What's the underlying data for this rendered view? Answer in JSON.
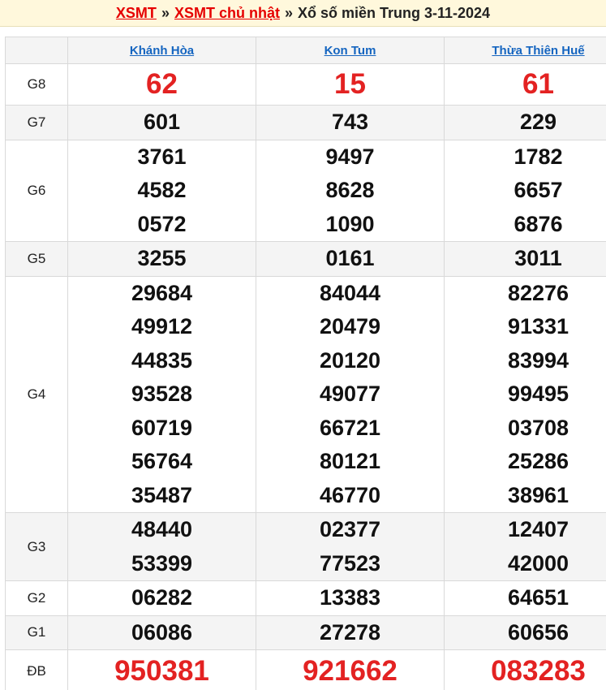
{
  "header": {
    "link1": "XSMT",
    "sep1": "»",
    "link2": "XSMT chủ nhật",
    "sep2": "»",
    "title": "Xổ số miền Trung 3-11-2024"
  },
  "provinces": [
    "Khánh Hòa",
    "Kon Tum",
    "Thừa Thiên Huế"
  ],
  "prizes": [
    {
      "label": "G8",
      "style": "big",
      "values": [
        [
          "62"
        ],
        [
          "15"
        ],
        [
          "61"
        ]
      ]
    },
    {
      "label": "G7",
      "style": "normal",
      "values": [
        [
          "601"
        ],
        [
          "743"
        ],
        [
          "229"
        ]
      ]
    },
    {
      "label": "G6",
      "style": "normal",
      "values": [
        [
          "3761",
          "4582",
          "0572"
        ],
        [
          "9497",
          "8628",
          "1090"
        ],
        [
          "1782",
          "6657",
          "6876"
        ]
      ]
    },
    {
      "label": "G5",
      "style": "normal",
      "values": [
        [
          "3255"
        ],
        [
          "0161"
        ],
        [
          "3011"
        ]
      ]
    },
    {
      "label": "G4",
      "style": "normal",
      "values": [
        [
          "29684",
          "49912",
          "44835",
          "93528",
          "60719",
          "56764",
          "35487"
        ],
        [
          "84044",
          "20479",
          "20120",
          "49077",
          "66721",
          "80121",
          "46770"
        ],
        [
          "82276",
          "91331",
          "83994",
          "99495",
          "03708",
          "25286",
          "38961"
        ]
      ]
    },
    {
      "label": "G3",
      "style": "normal",
      "values": [
        [
          "48440",
          "53399"
        ],
        [
          "02377",
          "77523"
        ],
        [
          "12407",
          "42000"
        ]
      ]
    },
    {
      "label": "G2",
      "style": "normal",
      "values": [
        [
          "06282"
        ],
        [
          "13383"
        ],
        [
          "64651"
        ]
      ]
    },
    {
      "label": "G1",
      "style": "normal",
      "values": [
        [
          "06086"
        ],
        [
          "27278"
        ],
        [
          "60656"
        ]
      ]
    },
    {
      "label": "ĐB",
      "style": "db",
      "values": [
        [
          "950381"
        ],
        [
          "921662"
        ],
        [
          "083283"
        ]
      ]
    }
  ],
  "colors": {
    "accent_red": "#e32222",
    "link_blue": "#1565c0",
    "header_bg": "#fff8dc",
    "row_shade": "#f4f4f4"
  }
}
